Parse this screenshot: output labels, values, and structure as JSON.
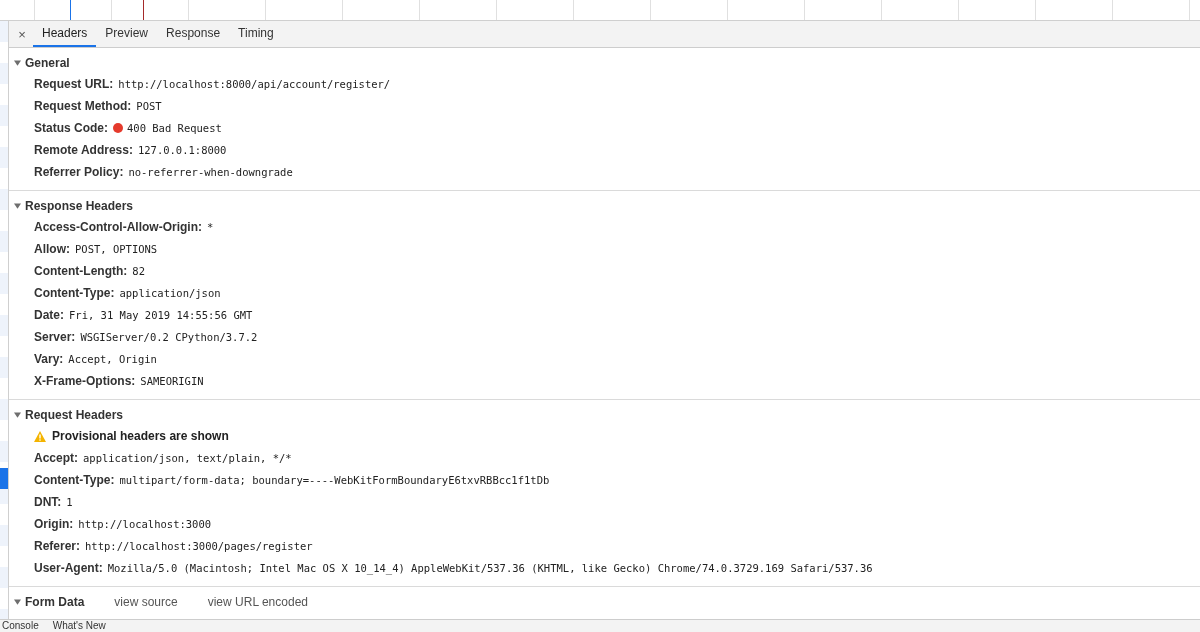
{
  "tabs": [
    {
      "label": "Headers",
      "selected": true
    },
    {
      "label": "Preview",
      "selected": false
    },
    {
      "label": "Response",
      "selected": false
    },
    {
      "label": "Timing",
      "selected": false
    }
  ],
  "close_label": "×",
  "sections": [
    {
      "title": "General",
      "expanded": true,
      "rows": [
        {
          "name": "Request URL:",
          "value": "http://localhost:8000/api/account/register/"
        },
        {
          "name": "Request Method:",
          "value": "POST"
        },
        {
          "name": "Status Code:",
          "value": "400 Bad Request",
          "kind": "status",
          "color": "#e53a2c"
        },
        {
          "name": "Remote Address:",
          "value": "127.0.0.1:8000"
        },
        {
          "name": "Referrer Policy:",
          "value": "no-referrer-when-downgrade"
        }
      ]
    },
    {
      "title": "Response Headers",
      "expanded": true,
      "rows": [
        {
          "name": "Access-Control-Allow-Origin:",
          "value": "*"
        },
        {
          "name": "Allow:",
          "value": "POST, OPTIONS"
        },
        {
          "name": "Content-Length:",
          "value": "82"
        },
        {
          "name": "Content-Type:",
          "value": "application/json"
        },
        {
          "name": "Date:",
          "value": "Fri, 31 May 2019 14:55:56 GMT"
        },
        {
          "name": "Server:",
          "value": "WSGIServer/0.2 CPython/3.7.2"
        },
        {
          "name": "Vary:",
          "value": "Accept, Origin"
        },
        {
          "name": "X-Frame-Options:",
          "value": "SAMEORIGIN"
        }
      ]
    },
    {
      "title": "Request Headers",
      "expanded": true,
      "warning": "Provisional headers are shown",
      "rows": [
        {
          "name": "Accept:",
          "value": "application/json, text/plain, */*"
        },
        {
          "name": "Content-Type:",
          "value": "multipart/form-data; boundary=----WebKitFormBoundaryE6txvRBBcc1f1tDb"
        },
        {
          "name": "DNT:",
          "value": "1"
        },
        {
          "name": "Origin:",
          "value": "http://localhost:3000"
        },
        {
          "name": "Referer:",
          "value": "http://localhost:3000/pages/register"
        },
        {
          "name": "User-Agent:",
          "value": "Mozilla/5.0 (Macintosh; Intel Mac OS X 10_14_4) AppleWebKit/537.36 (KHTML, like Gecko) Chrome/74.0.3729.169 Safari/537.36"
        }
      ]
    },
    {
      "title": "Form Data",
      "expanded": true,
      "links": [
        "view source",
        "view URL encoded"
      ]
    }
  ],
  "drawer_tabs": [
    {
      "label": "Console",
      "selected": false
    },
    {
      "label": "What's New",
      "selected": false
    }
  ]
}
